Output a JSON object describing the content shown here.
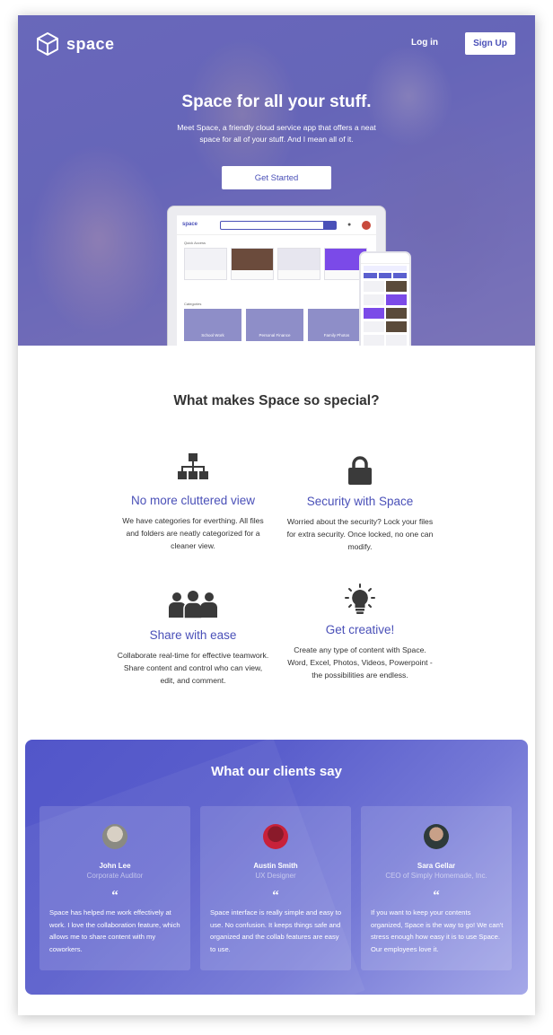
{
  "header": {
    "logo_text": "space",
    "login_label": "Log in",
    "signup_label": "Sign Up"
  },
  "hero": {
    "title": "Space for all your stuff.",
    "description": "Meet Space, a friendly cloud service app that offers a neat space for all of your stuff. And I mean all of it.",
    "cta_label": "Get Started",
    "mockup": {
      "app_logo": "space",
      "quick_access_label": "Quick Access",
      "categories_label": "Categories",
      "tiles": [
        "School Work",
        "Personal Finance",
        "Family Photos"
      ]
    }
  },
  "special": {
    "title": "What makes Space so special?",
    "features": [
      {
        "icon": "sitemap-icon",
        "title": "No more cluttered view",
        "text": "We have categories for everthing. All files and folders are neatly categorized for a cleaner view."
      },
      {
        "icon": "lock-icon",
        "title": "Security with Space",
        "text": "Worried about the security? Lock your files for extra security. Once locked, no one can modify."
      },
      {
        "icon": "users-icon",
        "title": "Share with ease",
        "text": "Collaborate real-time for effective teamwork. Share content and control who can view, edit, and comment."
      },
      {
        "icon": "lightbulb-icon",
        "title": "Get creative!",
        "text": "Create any type of content with Space. Word, Excel, Photos, Videos, Powerpoint - the possibilities are endless."
      }
    ]
  },
  "clients": {
    "title": "What our clients say",
    "testimonials": [
      {
        "name": "John Lee",
        "role": "Corporate Auditor",
        "quote_mark": "“",
        "text": "Space has helped me work effectively at work. I love the collaboration feature, which allows me to share content with my coworkers."
      },
      {
        "name": "Austin Smith",
        "role": "UX Designer",
        "quote_mark": "“",
        "text": "Space interface is really simple and easy to use. No confusion. It keeps things safe and organized and the collab features are easy to use."
      },
      {
        "name": "Sara Gellar",
        "role": "CEO of Simply Homemade, Inc.",
        "quote_mark": "“",
        "text": "If you want to keep your contents organized, Space is the way to go! We can't stress enough how easy it is to use Space. Our employees love it."
      }
    ]
  },
  "colors": {
    "accent": "#4a50b8",
    "hero_overlay": "#6a69b6",
    "clients_gradient_start": "#5256c9",
    "clients_gradient_end": "#a5a8e8"
  }
}
